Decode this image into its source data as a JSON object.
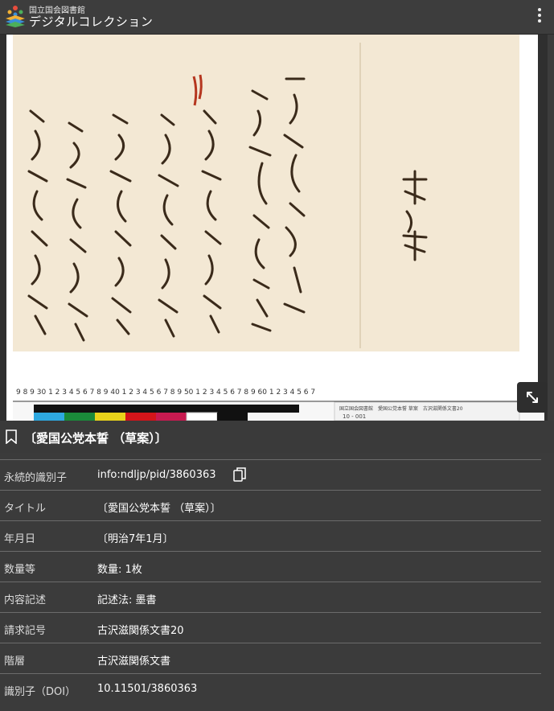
{
  "header": {
    "org_name": "国立国会図書館",
    "app_name": "デジタルコレクション"
  },
  "viewer": {
    "heading_text": "本誓",
    "card_text": "国立国会図書館　愛国公党本誓 草案　古沢滋関係文書20",
    "card_number": "10 - 001"
  },
  "document": {
    "title": "〔愛国公党本誓 （草案）〕"
  },
  "metadata": [
    {
      "label": "永続的識別子",
      "value": "info:ndljp/pid/3860363"
    },
    {
      "label": "タイトル",
      "value": "〔愛国公党本誓 （草案）〕"
    },
    {
      "label": "年月日",
      "value": "〔明治7年1月〕"
    },
    {
      "label": "数量等",
      "value": "数量: 1枚"
    },
    {
      "label": "内容記述",
      "value": "記述法: 墨書"
    },
    {
      "label": "請求記号",
      "value": "古沢滋関係文書20"
    },
    {
      "label": "階層",
      "value": "古沢滋関係文書"
    },
    {
      "label": "識別子（DOI）",
      "value": "10.11501/3860363"
    }
  ],
  "colors": {
    "background": "#3b3b3b",
    "paper": "#f3e8d4",
    "ink": "#3a2a1a"
  }
}
